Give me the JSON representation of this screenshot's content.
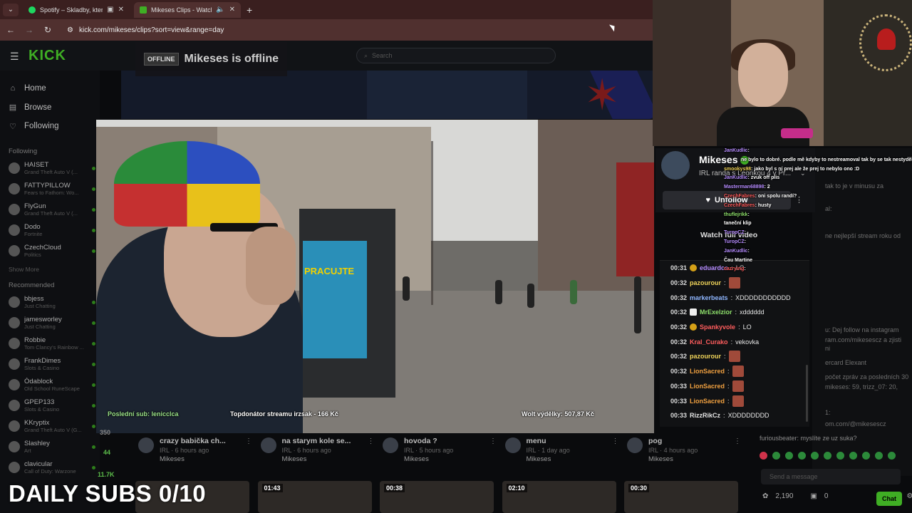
{
  "browser": {
    "tabs": [
      {
        "title": "Spotify – Skladby, které se l",
        "active": false
      },
      {
        "title": "Mikeses Clips - Watch Live",
        "active": true
      }
    ],
    "url": "kick.com/mikeses/clips?sort=view&range=day"
  },
  "kick": {
    "logo": "KICK",
    "search_placeholder": "Search",
    "nav": [
      {
        "label": "Home",
        "icon": "home-icon"
      },
      {
        "label": "Browse",
        "icon": "browse-icon"
      },
      {
        "label": "Following",
        "icon": "heart-icon"
      }
    ],
    "following_header": "Following",
    "following": [
      {
        "name": "HAISET",
        "game": "Grand Theft Auto V (..."
      },
      {
        "name": "FATTYPILLOW",
        "game": "Fears to Fathom: Wo..."
      },
      {
        "name": "FlyGun",
        "game": "Grand Theft Auto V (..."
      },
      {
        "name": "Dodo",
        "game": "Fortnite"
      },
      {
        "name": "CzechCloud",
        "game": "Politics"
      }
    ],
    "show_more": "Show More",
    "recommended_header": "Recommended",
    "recommended": [
      {
        "name": "bbjess",
        "game": "Just Chatting"
      },
      {
        "name": "jamesworley",
        "game": "Just Chatting"
      },
      {
        "name": "Robbie",
        "game": "Tom Clancy's Rainbow ..."
      },
      {
        "name": "FrankDimes",
        "game": "Slots & Casino"
      },
      {
        "name": "Ódablock",
        "game": "Old School RuneScape"
      },
      {
        "name": "GPEP133",
        "game": "Slots & Casino"
      },
      {
        "name": "KKryptix",
        "game": "Grand Theft Auto V (G..."
      },
      {
        "name": "Slashley",
        "game": "Art"
      },
      {
        "name": "clavicular",
        "game": "Call of Duty: Warzone"
      }
    ],
    "side_counts": [
      "44",
      "11.7K",
      "350"
    ],
    "offline_tag": "OFFLINE",
    "offline_text": "Mikeses is offline"
  },
  "stream_overlay": {
    "last_sub": "Poslední sub: lenicclca",
    "top_donator": "Topdonátor streamu irzsak - 166 Kč",
    "wolt": "Wolt výdělky: 507,87 Kč",
    "poster": "PRACUJTE",
    "daily_subs": "DAILY SUBS 0/10"
  },
  "channel": {
    "name": "Mikeses",
    "subtitle": "IRL randa s Leonkou 4 v Pr...",
    "unfollow": "Unfollow",
    "watch_full": "Watch full video"
  },
  "chat": [
    {
      "ts": "00:31",
      "user": "eduardcs",
      "msg": "LO",
      "color": "#b68cff",
      "badge": "coin"
    },
    {
      "ts": "00:32",
      "user": "pazourour",
      "msg": "",
      "color": "#f0d45a",
      "emote": true
    },
    {
      "ts": "00:32",
      "user": "markerbeats",
      "msg": "XDDDDDDDDDDD",
      "color": "#8fb6ff"
    },
    {
      "ts": "00:32",
      "user": "MrExelzior",
      "msg": "xdddddd",
      "color": "#8ee06b",
      "badge": "square"
    },
    {
      "ts": "00:32",
      "user": "Spankyvole",
      "msg": "LO",
      "color": "#ff5d5d",
      "badge": "coin"
    },
    {
      "ts": "00:32",
      "user": "Kral_Curako",
      "msg": "vekovka",
      "color": "#ff5d5d"
    },
    {
      "ts": "00:32",
      "user": "pazourour",
      "msg": "",
      "color": "#f0d45a",
      "emote": true
    },
    {
      "ts": "00:32",
      "user": "LionSacred",
      "msg": "",
      "color": "#f0a040",
      "emote": true
    },
    {
      "ts": "00:33",
      "user": "LionSacred",
      "msg": "",
      "color": "#f0a040",
      "emote": true
    },
    {
      "ts": "00:33",
      "user": "LionSacred",
      "msg": "",
      "color": "#f0a040",
      "emote": true
    },
    {
      "ts": "00:33",
      "user": "RizzRikCz",
      "msg": "XDDDDDDDD",
      "color": "#e6e6e6"
    }
  ],
  "overlay_chat": [
    {
      "user": "JanKudlic",
      "msg": "",
      "cls": ""
    },
    {
      "user": "",
      "msg": "ne bylo to dobré. podle mě kdyby to nestreamoval tak by se tak nestydělo",
      "cls": ""
    },
    {
      "user": "smookys98",
      "msg": "jako byl s ní prej ale že prej to nebylo ono :D",
      "cls": "y"
    },
    {
      "user": "JanKudlic",
      "msg": "zvuk off plis",
      "cls": ""
    },
    {
      "user": "Masterman68898",
      "msg": "2",
      "cls": ""
    },
    {
      "user": "CzechFabres",
      "msg": "oni spolu randí?",
      "cls": "r"
    },
    {
      "user": "CzechFabres",
      "msg": "husty",
      "cls": "r"
    },
    {
      "user": "thuflejrikk",
      "msg": "",
      "cls": "g"
    },
    {
      "user": "",
      "msg": "taneční klip",
      "cls": ""
    },
    {
      "user": "TuropCZ",
      "msg": "",
      "cls": ""
    },
    {
      "user": "TuropCZ",
      "msg": "",
      "cls": ""
    },
    {
      "user": "JanKudlic",
      "msg": "",
      "cls": ""
    },
    {
      "user": "",
      "msg": "Čau Martine",
      "cls": ""
    },
    {
      "user": "cazrying",
      "msg": "",
      "cls": "r"
    }
  ],
  "bg_chat": [
    "tak to je v minusu za",
    "al:",
    "ne nejlepší stream roku od",
    "u: Dej follow na instagram",
    "ram.com/mikesescz a zjisti",
    "ni",
    "ercard Elexant",
    "počet zpráv za posledních 30",
    "mikeses: 59, trizz_07: 20,",
    "1:",
    "om.com/@mikesescz",
    "furiousbeater: myslíte ze uz suka?"
  ],
  "send_placeholder": "Send a message",
  "points": "2,190",
  "gifts": "0",
  "chat_button": "Chat",
  "clips": [
    {
      "title": "crazy babička ch...",
      "meta": "IRL · 6 hours ago",
      "user": "Mikeses"
    },
    {
      "title": "na starym kole se...",
      "meta": "IRL · 6 hours ago",
      "user": "Mikeses"
    },
    {
      "title": "hovoda ?",
      "meta": "IRL · 5 hours ago",
      "user": "Mikeses"
    },
    {
      "title": "menu",
      "meta": "IRL · 1 day ago",
      "user": "Mikeses"
    },
    {
      "title": "pog",
      "meta": "IRL · 4 hours ago",
      "user": "Mikeses"
    }
  ],
  "thumb_durations": [
    "",
    "01:43",
    "00:38",
    "02:10",
    "00:30"
  ]
}
